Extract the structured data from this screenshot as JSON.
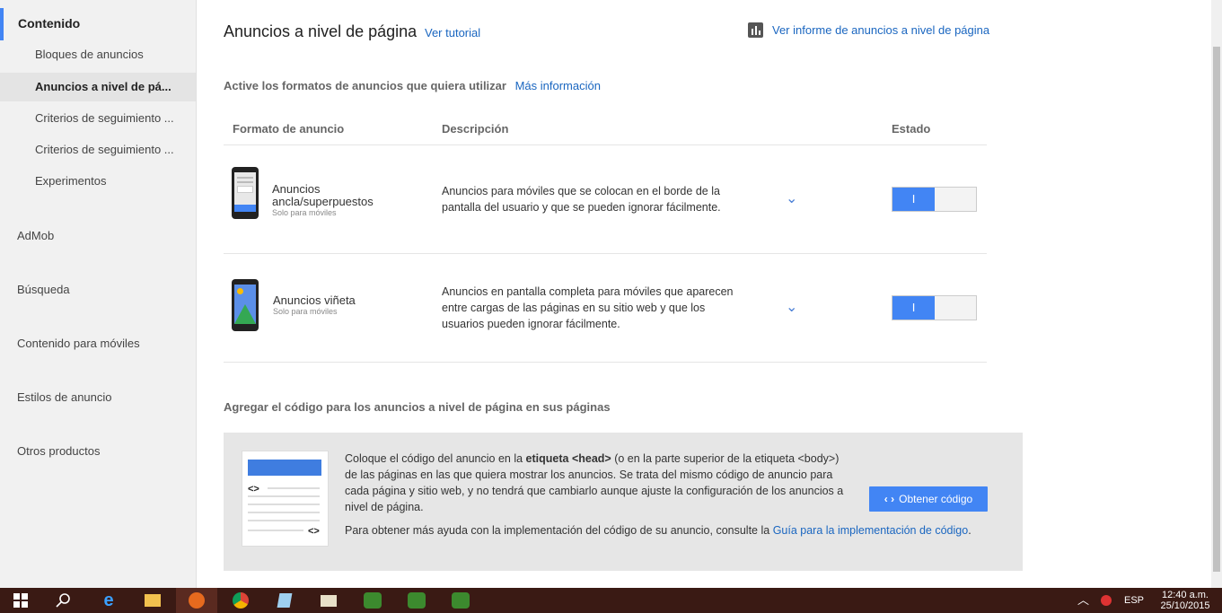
{
  "sidebar": {
    "section_title": "Contenido",
    "sub_items": [
      {
        "label": "Bloques de anuncios",
        "active": false
      },
      {
        "label": "Anuncios a nivel de pá...",
        "active": true
      },
      {
        "label": "Criterios de seguimiento ...",
        "active": false
      },
      {
        "label": "Criterios de seguimiento ...",
        "active": false
      },
      {
        "label": "Experimentos",
        "active": false
      }
    ],
    "sections": [
      "AdMob",
      "Búsqueda",
      "Contenido para móviles",
      "Estilos de anuncio",
      "Otros productos"
    ]
  },
  "header": {
    "title": "Anuncios a nivel de página",
    "tutorial_link": "Ver tutorial",
    "report_link": "Ver informe de anuncios a nivel de página",
    "report_icon": "bar-chart-icon"
  },
  "formats_section": {
    "heading": "Active los formatos de anuncios que quiera utilizar",
    "more_info_link": "Más información",
    "columns": [
      "Formato de anuncio",
      "Descripción",
      "Estado"
    ],
    "rows": [
      {
        "name_line1": "Anuncios",
        "name_line2": "ancla/superpuestos",
        "note": "Solo para móviles",
        "description": "Anuncios para móviles que se colocan en el borde de la pantalla del usuario y que se pueden ignorar fácilmente.",
        "toggle_label": "I",
        "enabled": true
      },
      {
        "name_line1": "Anuncios viñeta",
        "note": "Solo para móviles",
        "description": "Anuncios en pantalla completa para móviles que aparecen entre cargas de las páginas en su sitio web y que los usuarios pueden ignorar fácilmente.",
        "toggle_label": "I",
        "enabled": true
      }
    ]
  },
  "code_section": {
    "heading": "Agregar el código para los anuncios a nivel de página en sus páginas",
    "text_before_bold": "Coloque el código del anuncio en la ",
    "bold": "etiqueta <head>",
    "text_after_bold": " (o en la parte superior de la etiqueta <body>) de las páginas en las que quiera mostrar los anuncios. Se trata del mismo código de anuncio para cada página y sitio web, y no tendrá que cambiarlo aunque ajuste la configuración de los anuncios a nivel de página.",
    "help_text": "Para obtener más ayuda con la implementación del código de su anuncio, consulte la ",
    "help_link": "Guía para la implementación de código",
    "help_end": ".",
    "button_label": "Obtener código",
    "code_glyph": "<>",
    "code_glyph2": "<>"
  },
  "taskbar": {
    "language": "ESP",
    "time": "12:40 a.m.",
    "date": "25/10/2015"
  },
  "colors": {
    "accent": "#4285f4",
    "link": "#1a66c0",
    "taskbar": "#3a1a14"
  }
}
